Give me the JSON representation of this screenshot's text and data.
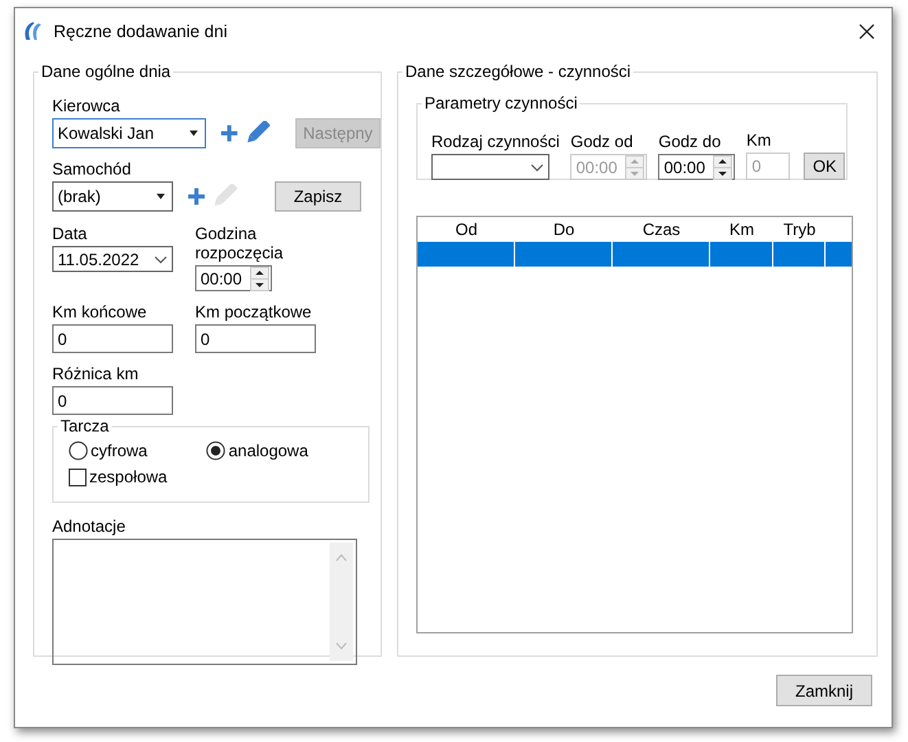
{
  "window": {
    "title": "Ręczne dodawanie dni"
  },
  "general": {
    "title": "Dane ogólne dnia",
    "driver": {
      "label": "Kierowca",
      "value": "Kowalski Jan",
      "edit_disabled": false
    },
    "next_button": {
      "label": "Następny",
      "disabled": true
    },
    "car": {
      "label": "Samochód",
      "value": "(brak)",
      "edit_disabled": true
    },
    "save_button": {
      "label": "Zapisz",
      "disabled": false
    },
    "date": {
      "label": "Data",
      "value": "11.05.2022"
    },
    "start_time": {
      "label": "Godzina rozpoczęcia",
      "value": "00:00"
    },
    "km_end": {
      "label": "Km końcowe",
      "value": "0"
    },
    "km_start": {
      "label": "Km początkowe",
      "value": "0"
    },
    "km_diff": {
      "label": "Różnica km",
      "value": "0"
    },
    "disc": {
      "title": "Tarcza",
      "options": [
        {
          "label": "cyfrowa",
          "selected": false
        },
        {
          "label": "analogowa",
          "selected": true
        }
      ],
      "team": {
        "label": "zespołowa",
        "checked": false
      }
    },
    "notes": {
      "label": "Adnotacje"
    }
  },
  "details": {
    "title": "Dane szczegółowe - czynności",
    "params": {
      "title": "Parametry czynności",
      "fields": [
        {
          "kind": "dropdown",
          "label": "Rodzaj czynności",
          "disabled": false
        },
        {
          "kind": "time",
          "label": "Godz od",
          "value": "00:00",
          "disabled": true
        },
        {
          "kind": "time",
          "label": "Godz do",
          "value": "00:00",
          "disabled": false
        },
        {
          "kind": "text",
          "label": "Km",
          "value": "0",
          "disabled": true
        }
      ],
      "ok_button": {
        "label": "OK"
      }
    },
    "table": {
      "columns": [
        "Od",
        "Do",
        "Czas",
        "Km",
        "Tryb"
      ],
      "rows": [
        {
          "selected": true
        }
      ]
    }
  },
  "close_button": {
    "label": "Zamknij"
  }
}
